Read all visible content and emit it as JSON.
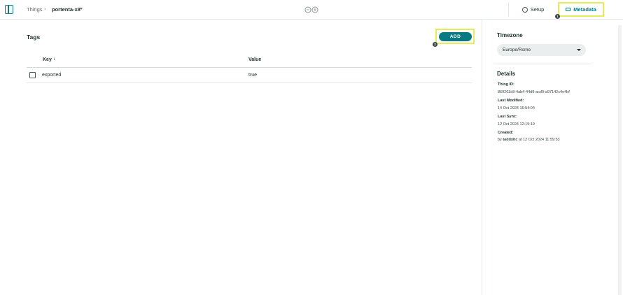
{
  "header": {
    "breadcrumb_root": "Things",
    "breadcrumb_separator": "›",
    "breadcrumb_current": "portenta-x8",
    "tabs": [
      {
        "label": "Setup",
        "icon": "gear-icon"
      },
      {
        "label": "Metadata",
        "icon": "tag-icon",
        "active": true
      }
    ],
    "badges": [
      "1",
      "2"
    ]
  },
  "main": {
    "title": "Tags",
    "add_label": "ADD",
    "table": {
      "columns": [
        "Key",
        "Value"
      ],
      "sort_indicator": "↓",
      "rows": [
        {
          "key": "exported",
          "value": "true"
        }
      ]
    }
  },
  "panel": {
    "timezone_title": "Timezone",
    "timezone_value": "Europe/Rome",
    "details_title": "Details",
    "thing_id_label": "Thing ID:",
    "thing_id": "869263c8-4ab4-44d9-acd0-a97142c4e4bf",
    "last_modified_label": "Last Modified:",
    "last_modified": "14 Oct 2024 15:54:04",
    "last_sync_label": "Last Sync:",
    "last_sync": "12 Oct 2024 12:15:19",
    "created_label": "Created:",
    "created_by_prefix": "by",
    "created_by": "taddyhc",
    "created_at_prefix": "at",
    "created_at": "12 Oct 2024 11:59:53"
  },
  "colors": {
    "accent": "#0a7b83",
    "highlight": "#e5ec59"
  }
}
